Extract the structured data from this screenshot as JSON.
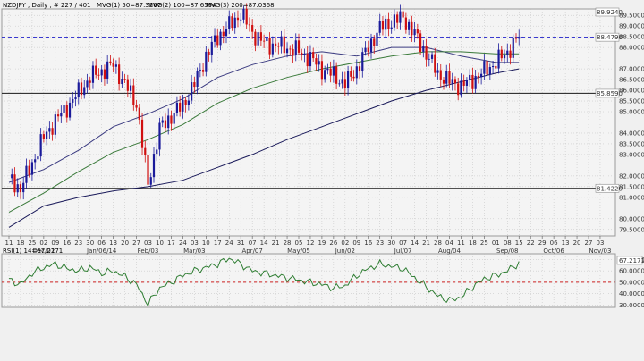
{
  "header": {
    "symbol": "NZDJPY , Daily , # 227 / 401",
    "ma1": "MVG(1) 50=87.3267",
    "ma2": "MVG(2) 100=87.6594",
    "ma3": "MVG(3) 200=87.0368"
  },
  "rsi_header": "RSI(1) 14=67.2171",
  "colors": {
    "up_candle": "#1a1a9a",
    "down_candle": "#d01010",
    "ma50": "#3a3a80",
    "ma100": "#3a7a3a",
    "ma200": "#1a1a5a",
    "rsi_line": "#2e7d32",
    "dashed_level": "#2222cc",
    "rsi_ref": "#cc2222",
    "grid": "#bfbfbf"
  },
  "chart_data": [
    {
      "type": "candlestick",
      "title": "NZDJPY , Daily",
      "ylim": [
        79.2,
        89.8
      ],
      "y_ticks": [
        79.5,
        80.0,
        81.0,
        81.5,
        82.0,
        83.0,
        83.5,
        84.0,
        85.0,
        85.5,
        86.0,
        86.5,
        87.0,
        88.0,
        88.5,
        89.0,
        89.5
      ],
      "y_tick_labels": [
        "79.5000",
        "80.0000",
        "81.0000",
        "81.5000",
        "82.0000",
        "83.0000",
        "83.5000",
        "84.0000",
        "85.0000",
        "85.5000",
        "86.0000",
        "86.5000",
        "87.0000",
        "88.0000",
        "88.5000",
        "89.0000",
        "89.5000"
      ],
      "marked_levels": [
        {
          "label": "89.9240",
          "value": 89.924,
          "style": "top"
        },
        {
          "label": "88.4790",
          "value": 88.479,
          "style": "dashed"
        },
        {
          "label": "85.8590",
          "value": 85.859,
          "style": "solid"
        },
        {
          "label": "81.4220",
          "value": 81.422,
          "style": "solid"
        }
      ],
      "x_day_labels": [
        "11",
        "18",
        "25",
        "02",
        "09",
        "16",
        "23",
        "30",
        "06",
        "13",
        "20",
        "27",
        "03",
        "10",
        "17",
        "24",
        "03",
        "10",
        "17",
        "24",
        "31",
        "07",
        "14",
        "21",
        "28",
        "05",
        "12",
        "19",
        "26",
        "02",
        "09",
        "16",
        "23",
        "30",
        "07",
        "14",
        "21",
        "28",
        "04",
        "11",
        "18",
        "25",
        "01",
        "08",
        "15",
        "22",
        "29",
        "06",
        "13",
        "20",
        "27",
        "03"
      ],
      "x_month_labels": [
        {
          "label": "Dec/02",
          "at": 3
        },
        {
          "label": "Jan/06/14",
          "at": 8
        },
        {
          "label": "Feb/03",
          "at": 12
        },
        {
          "label": "Mar/03",
          "at": 16
        },
        {
          "label": "Apr/07",
          "at": 21
        },
        {
          "label": "May/05",
          "at": 25
        },
        {
          "label": "Jun/02",
          "at": 29
        },
        {
          "label": "Jul/07",
          "at": 34
        },
        {
          "label": "Aug/04",
          "at": 38
        },
        {
          "label": "Sep/08",
          "at": 43
        },
        {
          "label": "Oct/06",
          "at": 47
        },
        {
          "label": "Nov/03",
          "at": 51
        }
      ],
      "close_path": [
        [
          0,
          81.9
        ],
        [
          1,
          81.4
        ],
        [
          2,
          82.6
        ],
        [
          3,
          83.8
        ],
        [
          4,
          84.6
        ],
        [
          5,
          85.2
        ],
        [
          6,
          85.9
        ],
        [
          7,
          86.6
        ],
        [
          8,
          86.9
        ],
        [
          9,
          87.2
        ],
        [
          10,
          86.3
        ],
        [
          11,
          85.4
        ],
        [
          12,
          81.6
        ],
        [
          13,
          84.2
        ],
        [
          14,
          84.8
        ],
        [
          15,
          85.3
        ],
        [
          16,
          86.3
        ],
        [
          17,
          87.6
        ],
        [
          18,
          88.5
        ],
        [
          19,
          89.0
        ],
        [
          20,
          89.6
        ],
        [
          21,
          88.7
        ],
        [
          22,
          88.2
        ],
        [
          23,
          88.1
        ],
        [
          24,
          88.0
        ],
        [
          25,
          87.8
        ],
        [
          26,
          87.5
        ],
        [
          27,
          87.0
        ],
        [
          28,
          86.7
        ],
        [
          29,
          86.3
        ],
        [
          30,
          87.0
        ],
        [
          31,
          88.0
        ],
        [
          32,
          88.9
        ],
        [
          33,
          89.2
        ],
        [
          34,
          89.4
        ],
        [
          35,
          88.6
        ],
        [
          36,
          87.7
        ],
        [
          37,
          86.8
        ],
        [
          38,
          86.4
        ],
        [
          39,
          86.2
        ],
        [
          40,
          86.5
        ],
        [
          41,
          86.9
        ],
        [
          42,
          87.3
        ],
        [
          43,
          87.8
        ],
        [
          44,
          88.5
        ]
      ],
      "series": [
        {
          "name": "MVG(1) 50",
          "points": [
            [
              0,
              81.7
            ],
            [
              3,
              82.3
            ],
            [
              6,
              83.2
            ],
            [
              9,
              84.3
            ],
            [
              12,
              84.9
            ],
            [
              15,
              85.6
            ],
            [
              18,
              86.6
            ],
            [
              21,
              87.2
            ],
            [
              24,
              87.6
            ],
            [
              27,
              87.8
            ],
            [
              30,
              87.6
            ],
            [
              33,
              88.0
            ],
            [
              36,
              88.0
            ],
            [
              39,
              87.6
            ],
            [
              42,
              87.3
            ],
            [
              44,
              87.3
            ]
          ]
        },
        {
          "name": "MVG(2) 100",
          "points": [
            [
              0,
              80.3
            ],
            [
              3,
              81.2
            ],
            [
              6,
              82.2
            ],
            [
              9,
              83.1
            ],
            [
              12,
              83.7
            ],
            [
              15,
              84.4
            ],
            [
              18,
              85.4
            ],
            [
              21,
              86.1
            ],
            [
              24,
              86.6
            ],
            [
              27,
              87.0
            ],
            [
              30,
              87.3
            ],
            [
              33,
              87.6
            ],
            [
              36,
              87.8
            ],
            [
              39,
              87.8
            ],
            [
              42,
              87.7
            ],
            [
              44,
              87.7
            ]
          ]
        },
        {
          "name": "MVG(3) 200",
          "points": [
            [
              0,
              79.6
            ],
            [
              3,
              80.6
            ],
            [
              6,
              81.0
            ],
            [
              9,
              81.3
            ],
            [
              12,
              81.5
            ],
            [
              15,
              81.8
            ],
            [
              18,
              82.4
            ],
            [
              21,
              83.0
            ],
            [
              24,
              83.7
            ],
            [
              27,
              84.3
            ],
            [
              30,
              84.9
            ],
            [
              33,
              85.5
            ],
            [
              36,
              86.0
            ],
            [
              39,
              86.4
            ],
            [
              42,
              86.8
            ],
            [
              44,
              87.0
            ]
          ]
        }
      ]
    },
    {
      "type": "line",
      "title": "RSI(1) 14",
      "ylim": [
        28,
        75
      ],
      "y_ticks": [
        30,
        40,
        50,
        60,
        70
      ],
      "y_tick_labels": [
        "30.0000",
        "40.0000",
        "50.0000",
        "60.0000",
        "70.0000"
      ],
      "marked_levels": [
        {
          "label": "67.2171",
          "value": 67.2171,
          "style": "highlight"
        },
        {
          "label": "",
          "value": 50,
          "style": "dashed"
        }
      ],
      "series": [
        {
          "name": "RSI",
          "points": [
            [
              0,
              52
            ],
            [
              1,
              48
            ],
            [
              2,
              58
            ],
            [
              3,
              63
            ],
            [
              4,
              66
            ],
            [
              5,
              62
            ],
            [
              6,
              60
            ],
            [
              7,
              63
            ],
            [
              8,
              58
            ],
            [
              9,
              60
            ],
            [
              10,
              55
            ],
            [
              11,
              48
            ],
            [
              12,
              31
            ],
            [
              13,
              45
            ],
            [
              14,
              50
            ],
            [
              15,
              56
            ],
            [
              16,
              60
            ],
            [
              17,
              63
            ],
            [
              18,
              66
            ],
            [
              19,
              71
            ],
            [
              20,
              66
            ],
            [
              21,
              60
            ],
            [
              22,
              58
            ],
            [
              23,
              56
            ],
            [
              24,
              54
            ],
            [
              25,
              52
            ],
            [
              26,
              50
            ],
            [
              27,
              48
            ],
            [
              28,
              45
            ],
            [
              29,
              47
            ],
            [
              30,
              56
            ],
            [
              31,
              62
            ],
            [
              32,
              66
            ],
            [
              33,
              64
            ],
            [
              34,
              62
            ],
            [
              35,
              54
            ],
            [
              36,
              46
            ],
            [
              37,
              38
            ],
            [
              38,
              34
            ],
            [
              39,
              37
            ],
            [
              40,
              46
            ],
            [
              41,
              53
            ],
            [
              42,
              56
            ],
            [
              43,
              60
            ],
            [
              44,
              67
            ]
          ]
        }
      ]
    }
  ]
}
